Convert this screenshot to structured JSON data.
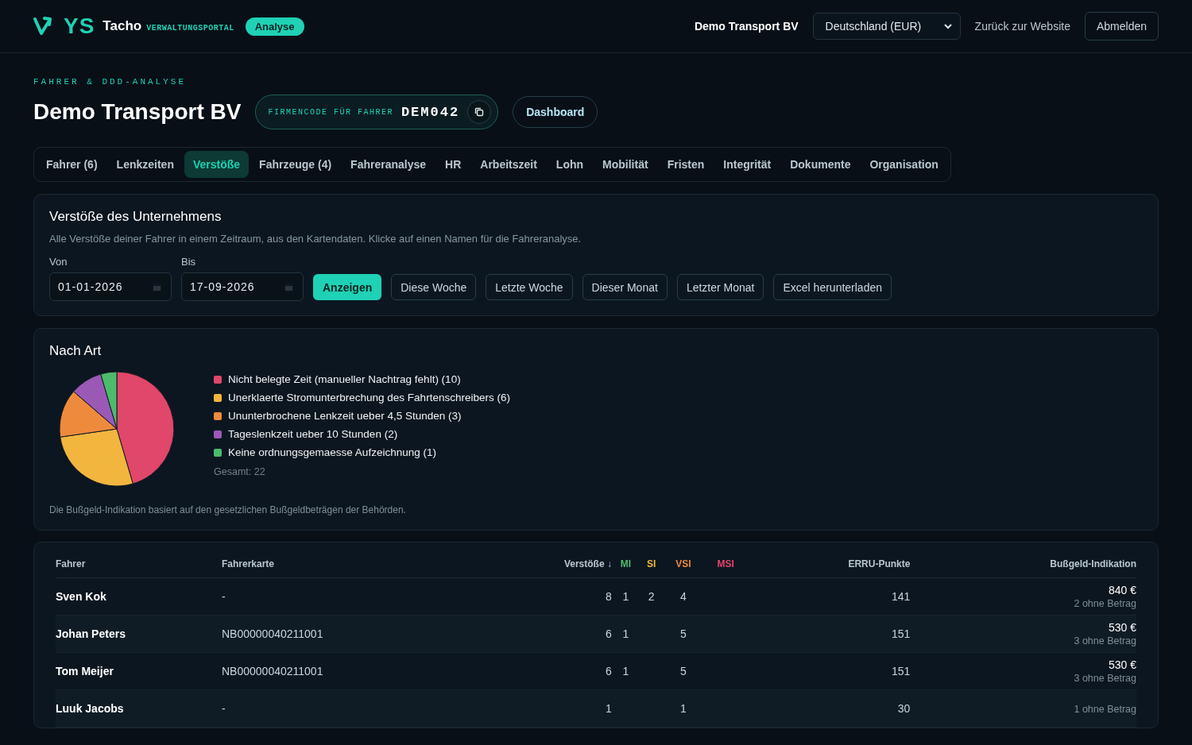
{
  "header": {
    "logo": "YS",
    "brand": "Tacho",
    "brand_sub": "VERWALTUNGSPORTAL",
    "badge": "Analyse",
    "company": "Demo Transport BV",
    "country_select": "Deutschland (EUR)",
    "back_link": "Zurück zur Website",
    "logout": "Abmelden"
  },
  "page": {
    "eyebrow": "FAHRER & DDD-ANALYSE",
    "title": "Demo Transport BV",
    "code_label": "FIRMENCODE FÜR FAHRER",
    "code": "DEM042",
    "dashboard": "Dashboard"
  },
  "tabs": [
    {
      "label": "Fahrer (6)",
      "selected": false
    },
    {
      "label": "Lenkzeiten",
      "selected": false
    },
    {
      "label": "Verstöße",
      "selected": true
    },
    {
      "label": "Fahrzeuge (4)",
      "selected": false
    },
    {
      "label": "Fahreranalyse",
      "selected": false
    },
    {
      "label": "HR",
      "selected": false
    },
    {
      "label": "Arbeitszeit",
      "selected": false
    },
    {
      "label": "Lohn",
      "selected": false
    },
    {
      "label": "Mobilität",
      "selected": false
    },
    {
      "label": "Fristen",
      "selected": false
    },
    {
      "label": "Integrität",
      "selected": false
    },
    {
      "label": "Dokumente",
      "selected": false
    },
    {
      "label": "Organisation",
      "selected": false
    }
  ],
  "filter": {
    "title": "Verstöße des Unternehmens",
    "description": "Alle Verstöße deiner Fahrer in einem Zeitraum, aus den Kartendaten. Klicke auf einen Namen für die Fahreranalyse.",
    "from_label": "Von",
    "from": "01-01-2026",
    "to_label": "Bis",
    "to": "17-09-2026",
    "buttons": [
      {
        "label": "Anzeigen",
        "kind": "primary"
      },
      {
        "label": "Diese Woche",
        "kind": "outline"
      },
      {
        "label": "Letzte Woche",
        "kind": "outline"
      },
      {
        "label": "Dieser Monat",
        "kind": "outline"
      },
      {
        "label": "Letzter Monat",
        "kind": "outline"
      },
      {
        "label": "Excel herunterladen",
        "kind": "outline"
      }
    ]
  },
  "by_type": {
    "title": "Nach Art",
    "chart_data": {
      "type": "pie",
      "categories": [
        "Nicht belegte Zeit (manueller Nachtrag fehlt) (10)",
        "Unerklaerte Stromunterbrechung des Fahrtenschreibers (6)",
        "Ununterbrochene Lenkzeit ueber 4,5 Stunden (3)",
        "Tageslenkzeit ueber 10 Stunden (2)",
        "Keine ordnungsgemaesse Aufzeichnung (1)"
      ],
      "values": [
        10,
        6,
        3,
        2,
        1
      ],
      "colors": [
        "#e0476a",
        "#f2b63f",
        "#ee8a3c",
        "#9b59b6",
        "#4cbb6c"
      ]
    },
    "total": "Gesamt: 22",
    "note": "Die Bußgeld-Indikation basiert auf den gesetzlichen Bußgeldbeträgen der Behörden."
  },
  "table": {
    "columns": [
      {
        "label": "Fahrer"
      },
      {
        "label": "Fahrerkarte"
      },
      {
        "label": "Verstöße ↓"
      },
      {
        "label": "MI",
        "color": "#4cbb6c"
      },
      {
        "label": "SI",
        "color": "#f2b63f"
      },
      {
        "label": "VSI",
        "color": "#ee8a3c"
      },
      {
        "label": "MSI",
        "color": "#e0476a"
      },
      {
        "label": "ERRU-Punkte"
      },
      {
        "label": "Bußgeld-Indikation"
      }
    ],
    "rows": [
      {
        "cells": [
          "Sven Kok",
          "-",
          "8",
          "1",
          "2",
          "4",
          "",
          "141"
        ],
        "amount": "840 €",
        "amount_note": "2 ohne Betrag"
      },
      {
        "cells": [
          "Johan Peters",
          "NB00000040211001",
          "6",
          "1",
          "",
          "5",
          "",
          "151"
        ],
        "amount": "530 €",
        "amount_note": "3 ohne Betrag"
      },
      {
        "cells": [
          "Tom Meijer",
          "NB00000040211001",
          "6",
          "1",
          "",
          "5",
          "",
          "151"
        ],
        "amount": "530 €",
        "amount_note": "3 ohne Betrag"
      },
      {
        "cells": [
          "Luuk Jacobs",
          "-",
          "1",
          "",
          "",
          "1",
          "",
          "30"
        ],
        "amount_note": "1 ohne Betrag"
      }
    ]
  }
}
